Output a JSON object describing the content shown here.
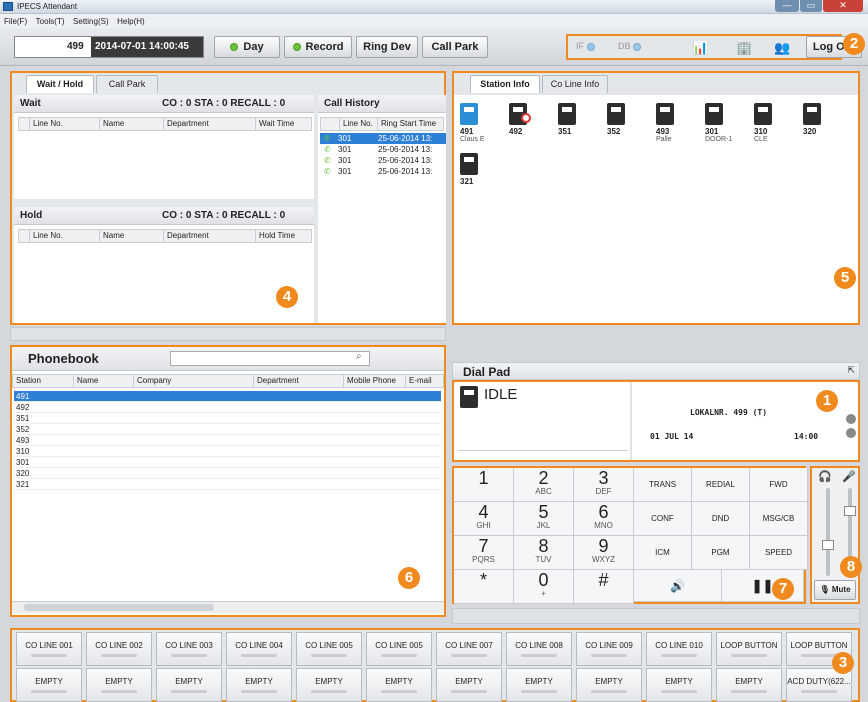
{
  "window": {
    "title": "IPECS Attendant"
  },
  "menu": [
    "File(F)",
    "Tools(T)",
    "Setting(S)",
    "Help(H)"
  ],
  "toolbar": {
    "station": "499",
    "datetime": "2014-07-01 14:00:45",
    "day": "Day",
    "record": "Record",
    "ring_dev": "Ring Dev",
    "call_park": "Call Park",
    "if_label": "IF",
    "db_label": "DB",
    "logout": "Log Out"
  },
  "left_top": {
    "tabs": [
      "Wait / Hold",
      "Call Park"
    ],
    "wait": {
      "title": "Wait",
      "counts": "CO : 0   STA : 0   RECALL : 0",
      "cols": [
        "Line No.",
        "Name",
        "Department",
        "Wait Time"
      ]
    },
    "hold": {
      "title": "Hold",
      "counts": "CO : 0   STA : 0   RECALL : 0",
      "cols": [
        "Line No.",
        "Name",
        "Department",
        "Hold Time"
      ]
    },
    "history": {
      "title": "Call History",
      "cols": [
        "Line No.",
        "Ring Start Time"
      ],
      "rows": [
        {
          "line": "301",
          "time": "25-06-2014 13:"
        },
        {
          "line": "301",
          "time": "25-06-2014 13:"
        },
        {
          "line": "301",
          "time": "25-06-2014 13:"
        },
        {
          "line": "301",
          "time": "25-06-2014 13:"
        }
      ]
    }
  },
  "stations": {
    "tabs": [
      "Station Info",
      "Co Line Info"
    ],
    "items": [
      {
        "num": "491",
        "sub": "Claus E"
      },
      {
        "num": "492",
        "sub": ""
      },
      {
        "num": "351",
        "sub": ""
      },
      {
        "num": "352",
        "sub": ""
      },
      {
        "num": "493",
        "sub": "Palle"
      },
      {
        "num": "301",
        "sub": "DOOR-1"
      },
      {
        "num": "310",
        "sub": "CLE"
      },
      {
        "num": "320",
        "sub": ""
      },
      {
        "num": "321",
        "sub": ""
      }
    ]
  },
  "phonebook": {
    "title": "Phonebook",
    "search_placeholder": "",
    "cols": [
      "Station",
      "Name",
      "Company",
      "Department",
      "Mobile Phone",
      "E-mail"
    ],
    "rows": [
      "491",
      "492",
      "351",
      "352",
      "493",
      "310",
      "301",
      "320",
      "321"
    ]
  },
  "dialpad": {
    "title": "Dial Pad",
    "status": "IDLE",
    "lcd_line1": "LOKALNR. 499 (T)",
    "lcd_date": "01 JUL 14",
    "lcd_time": "14:00",
    "keys": [
      {
        "n": "1",
        "s": ""
      },
      {
        "n": "2",
        "s": "ABC"
      },
      {
        "n": "3",
        "s": "DEF"
      },
      {
        "n": "4",
        "s": "GHI"
      },
      {
        "n": "5",
        "s": "JKL"
      },
      {
        "n": "6",
        "s": "MNO"
      },
      {
        "n": "7",
        "s": "PQRS"
      },
      {
        "n": "8",
        "s": "TUV"
      },
      {
        "n": "9",
        "s": "WXYZ"
      },
      {
        "n": "*",
        "s": ""
      },
      {
        "n": "0",
        "s": "+"
      },
      {
        "n": "#",
        "s": ""
      }
    ],
    "fkeys": [
      "TRANS",
      "REDIAL",
      "FWD",
      "CONF",
      "DND",
      "MSG/CB",
      "ICM",
      "PGM",
      "SPEED"
    ],
    "mute": "Mute"
  },
  "colines": {
    "top": [
      "CO LINE 001",
      "CO LINE 002",
      "CO LINE 003",
      "CO LINE 004",
      "CO LINE 005",
      "CO LINE 005",
      "CO LINE 007",
      "CO LINE 008",
      "CO LINE 009",
      "CO LINE 010",
      "LOOP BUTTON",
      "LOOP BUTTON"
    ],
    "bottom": [
      "EMPTY",
      "EMPTY",
      "EMPTY",
      "EMPTY",
      "EMPTY",
      "EMPTY",
      "EMPTY",
      "EMPTY",
      "EMPTY",
      "EMPTY",
      "EMPTY",
      "ACD DUTY(622..."
    ]
  },
  "badges": [
    "1",
    "2",
    "3",
    "4",
    "5",
    "6",
    "7",
    "8"
  ]
}
